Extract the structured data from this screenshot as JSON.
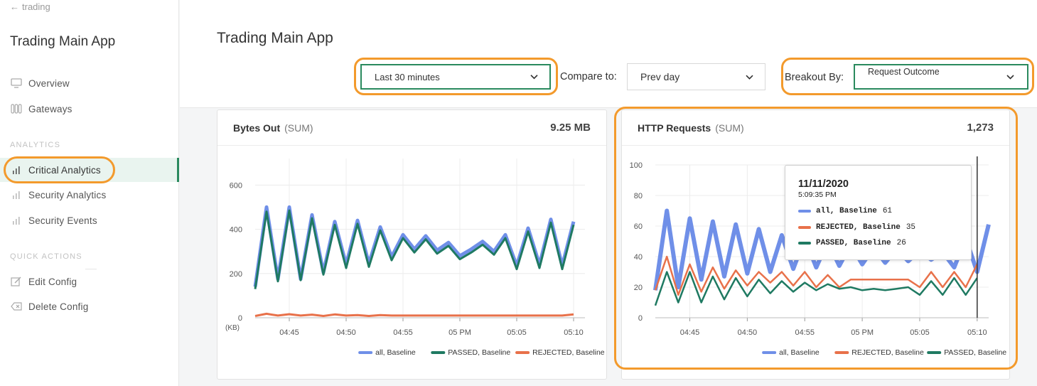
{
  "sidebar": {
    "back_label": "trading",
    "app_title": "Trading Main App",
    "nav": [
      {
        "label": "Overview",
        "icon": "monitor-icon"
      },
      {
        "label": "Gateways",
        "icon": "gateway-icon"
      }
    ],
    "analytics_label": "ANALYTICS",
    "analytics": [
      {
        "label": "Critical Analytics",
        "icon": "bar-chart-icon",
        "active": true
      },
      {
        "label": "Security Analytics",
        "icon": "bar-chart-icon"
      },
      {
        "label": "Security Events",
        "icon": "bar-chart-icon"
      }
    ],
    "quick_actions_label": "QUICK ACTIONS",
    "actions": [
      {
        "label": "Edit Config",
        "icon": "edit-icon"
      },
      {
        "label": "Delete Config",
        "icon": "delete-icon"
      }
    ]
  },
  "header": {
    "title": "Trading Main App",
    "time_range": "Last 30 minutes",
    "compare_label": "Compare to:",
    "compare_value": "Prev day",
    "breakout_label": "Breakout By:",
    "breakout_value": "Request Outcome"
  },
  "colors": {
    "all": "#6f8fe8",
    "passed": "#1f7a62",
    "rejected": "#e8714a",
    "highlight": "#f39a2c",
    "accent": "#2a8a5e"
  },
  "chart_data": [
    {
      "type": "line",
      "title": "Bytes Out",
      "aggregation": "(SUM)",
      "total": "9.25 MB",
      "ylabel": "(KB)",
      "ylim": [
        0,
        720
      ],
      "y_ticks": [
        0,
        200,
        400,
        600
      ],
      "x_ticks": [
        "04:45",
        "04:50",
        "04:55",
        "05 PM",
        "05:05",
        "05:10"
      ],
      "x_tick_minutes": [
        3,
        8,
        13,
        18,
        23,
        28
      ],
      "x_minutes": [
        0,
        1,
        2,
        3,
        4,
        5,
        6,
        7,
        8,
        9,
        10,
        11,
        12,
        13,
        14,
        15,
        16,
        17,
        18,
        19,
        20,
        21,
        22,
        23,
        24,
        25,
        26,
        27,
        28,
        29
      ],
      "series": [
        {
          "name": "all, Baseline",
          "color_key": "all",
          "values": [
            140,
            500,
            175,
            500,
            175,
            465,
            205,
            435,
            240,
            440,
            245,
            410,
            275,
            375,
            310,
            370,
            305,
            340,
            280,
            310,
            345,
            300,
            375,
            235,
            405,
            240,
            445,
            235,
            435,
            null
          ]
        },
        {
          "name": "PASSED, Baseline",
          "color_key": "passed",
          "values": [
            130,
            480,
            165,
            485,
            170,
            450,
            195,
            420,
            225,
            425,
            230,
            395,
            260,
            360,
            295,
            355,
            290,
            325,
            265,
            295,
            330,
            285,
            360,
            220,
            390,
            225,
            430,
            220,
            420,
            null
          ]
        },
        {
          "name": "REJECTED, Baseline",
          "color_key": "rejected",
          "values": [
            8,
            18,
            10,
            16,
            10,
            14,
            8,
            15,
            10,
            12,
            8,
            12,
            10,
            10,
            10,
            10,
            10,
            10,
            10,
            10,
            10,
            10,
            10,
            10,
            10,
            10,
            10,
            10,
            15,
            null
          ]
        }
      ]
    },
    {
      "type": "line",
      "title": "HTTP Requests",
      "aggregation": "(SUM)",
      "total": "1,273",
      "ylim": [
        0,
        100
      ],
      "y_ticks": [
        0,
        20,
        40,
        60,
        80,
        100
      ],
      "x_ticks": [
        "04:45",
        "04:50",
        "04:55",
        "05 PM",
        "05:05",
        "05:10"
      ],
      "x_tick_minutes": [
        3,
        8,
        13,
        18,
        23,
        28
      ],
      "x_minutes": [
        0,
        1,
        2,
        3,
        4,
        5,
        6,
        7,
        8,
        9,
        10,
        11,
        12,
        13,
        14,
        15,
        16,
        17,
        18,
        19,
        20,
        21,
        22,
        23,
        24,
        25,
        26,
        27,
        28,
        29
      ],
      "cursor_minute": 28,
      "tooltip": {
        "date": "11/11/2020",
        "time": "5:09:35 PM",
        "rows": [
          {
            "name": "all, Baseline",
            "value": 61,
            "color_key": "all"
          },
          {
            "name": "REJECTED, Baseline",
            "value": 35,
            "color_key": "rejected"
          },
          {
            "name": "PASSED, Baseline",
            "value": 26,
            "color_key": "passed"
          }
        ]
      },
      "series": [
        {
          "name": "all, Baseline",
          "color_key": "all",
          "values": [
            18,
            70,
            20,
            65,
            25,
            63,
            27,
            61,
            29,
            58,
            30,
            54,
            32,
            52,
            33,
            50,
            34,
            48,
            35,
            46,
            36,
            45,
            37,
            44,
            38,
            43,
            33,
            52,
            30,
            61
          ]
        },
        {
          "name": "REJECTED, Baseline",
          "color_key": "rejected",
          "values": [
            18,
            40,
            15,
            35,
            17,
            33,
            19,
            31,
            21,
            30,
            23,
            30,
            21,
            30,
            20,
            28,
            20,
            25,
            25,
            25,
            25,
            25,
            25,
            20,
            30,
            20,
            30,
            20,
            35,
            null
          ]
        },
        {
          "name": "PASSED, Baseline",
          "color_key": "passed",
          "values": [
            8,
            30,
            10,
            30,
            10,
            27,
            12,
            26,
            14,
            25,
            16,
            24,
            17,
            23,
            18,
            22,
            19,
            20,
            18,
            19,
            18,
            19,
            20,
            15,
            24,
            15,
            26,
            15,
            26,
            null
          ]
        }
      ]
    }
  ]
}
